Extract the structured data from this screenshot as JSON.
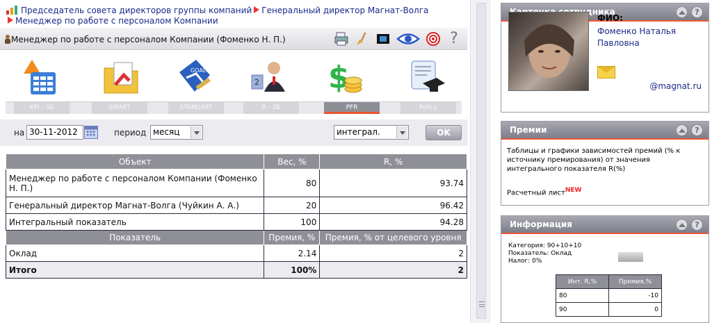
{
  "breadcrumb": {
    "item1": "Председатель совета директоров группы компаний",
    "item2": "Генеральный директор Магнат-Волга",
    "item3": "Менеджер по работе с персоналом Компании"
  },
  "header": {
    "title": "Менеджер по работе с персоналом Компании  (Фоменко Н. П.)"
  },
  "tabs": [
    {
      "label": "KPI - ЗБ"
    },
    {
      "label": "SMART"
    },
    {
      "label": "STANDART"
    },
    {
      "label": "R - ЗБ"
    },
    {
      "label": "PFR"
    },
    {
      "label": "Policy"
    }
  ],
  "params": {
    "date_label": "на",
    "date_value": "30-11-2012",
    "period_label": "период",
    "period_value": "месяц",
    "mode_value": "интеграл.",
    "ok_label": "OK"
  },
  "grid": {
    "headers": [
      "Объект",
      "Вес, %",
      "R, %"
    ],
    "rows": [
      {
        "object": "Менеджер по работе с персоналом Компании (Фоменко Н. П.)",
        "weight": "80",
        "r": "93.74"
      },
      {
        "object": "Генеральный директор Магнат-Волга (Чуйкин А. А.)",
        "weight": "20",
        "r": "96.42"
      },
      {
        "object": "Интегральный показатель",
        "weight": "100",
        "r": "94.28"
      }
    ],
    "sub_headers": [
      "Показатель",
      "Премия, %",
      "Премия, % от целевого уровня"
    ],
    "sub_rows": [
      {
        "name": "Оклад",
        "prem": "2.14",
        "target": "2"
      }
    ],
    "total": {
      "name": "Итого",
      "prem": "100%",
      "target": "2"
    }
  },
  "card_employee": {
    "title": "Карточка сотрудника",
    "fio_label": "ФИО:",
    "fio_value": "Фоменко Наталья Павловна",
    "email": "@magnat.ru"
  },
  "card_bonus": {
    "title": "Премии",
    "text": "Таблицы и графики зависимостей премий (% к источнику премирования) от значения интегрального показателя R(%)",
    "link": "Расчетный лист",
    "badge": "NEW"
  },
  "card_info": {
    "title": "Информация",
    "category": "Категория: 90+10+10",
    "indicator": "Показатель: Оклад",
    "tax": "Налог: 0%",
    "table_headers": [
      "Инт. R,%",
      "Премия,%"
    ],
    "table_rows": [
      {
        "r": "80",
        "p": "-10"
      },
      {
        "r": "90",
        "p": "0"
      }
    ]
  },
  "help_glyph": "?",
  "colors": {
    "accent_red": "#e53333",
    "header_gray": "#8f8f98",
    "link_blue": "#1a2a8a"
  }
}
